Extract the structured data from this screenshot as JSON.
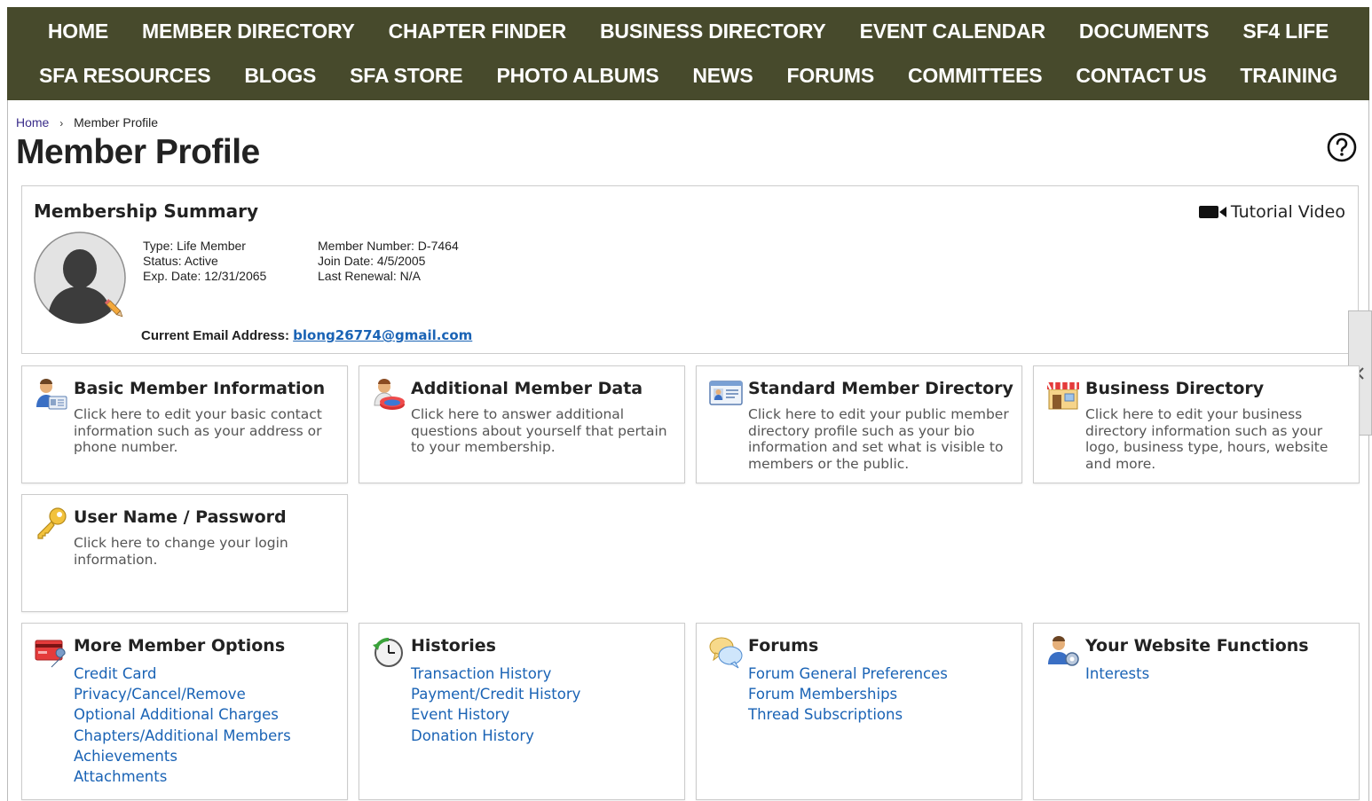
{
  "nav": {
    "row1": [
      "HOME",
      "MEMBER DIRECTORY",
      "CHAPTER FINDER",
      "BUSINESS DIRECTORY",
      "EVENT CALENDAR",
      "DOCUMENTS",
      "SF4 LIFE"
    ],
    "row2": [
      "SFA RESOURCES",
      "BLOGS",
      "SFA STORE",
      "PHOTO ALBUMS",
      "NEWS",
      "FORUMS",
      "COMMITTEES",
      "CONTACT US",
      "TRAINING"
    ]
  },
  "breadcrumb": {
    "home": "Home",
    "current": "Member Profile"
  },
  "page_title": "Member Profile",
  "summary": {
    "title": "Membership Summary",
    "tutorial": "Tutorial Video",
    "type": "Type: Life Member",
    "status": "Status: Active",
    "exp_date": "Exp. Date: 12/31/2065",
    "member_number": "Member Number: D-7464",
    "join_date": "Join Date: 4/5/2005",
    "last_renewal": "Last Renewal: N/A",
    "email_label": "Current Email Address:",
    "email": "blong26774@gmail.com"
  },
  "cards": {
    "basic": {
      "title": "Basic Member Information",
      "desc": "Click here to edit your basic contact information such as your address or phone number."
    },
    "additional": {
      "title": "Additional Member Data",
      "desc": "Click here to answer additional questions about yourself that pertain to your membership."
    },
    "standard": {
      "title": "Standard Member Directory",
      "desc": "Click here to edit your public member directory profile such as your bio information and set what is visible to members or the public."
    },
    "business": {
      "title": "Business Directory",
      "desc": "Click here to edit your business directory information such as your logo, business type, hours, website and more."
    },
    "username": {
      "title": "User Name / Password",
      "desc": "Click here to change your login information."
    },
    "more": {
      "title": "More Member Options",
      "links": [
        "Credit Card",
        "Privacy/Cancel/Remove",
        "Optional Additional Charges",
        "Chapters/Additional Members",
        "Achievements",
        "Attachments"
      ]
    },
    "histories": {
      "title": "Histories",
      "links": [
        "Transaction History",
        "Payment/Credit History",
        "Event History",
        "Donation History"
      ]
    },
    "forums": {
      "title": "Forums",
      "links": [
        "Forum General Preferences",
        "Forum Memberships",
        "Thread Subscriptions"
      ]
    },
    "website": {
      "title": "Your Website Functions",
      "links": [
        "Interests"
      ]
    }
  },
  "colors": {
    "nav_bg": "#474a2c",
    "link": "#1a63b5",
    "breadcrumb_link": "#3a2c8a"
  }
}
